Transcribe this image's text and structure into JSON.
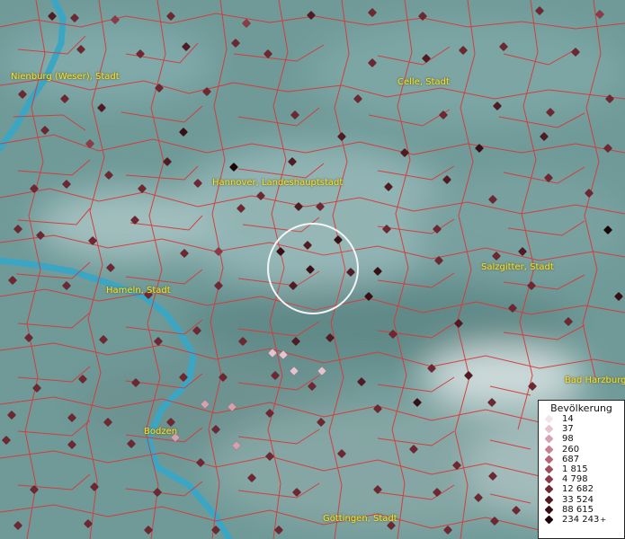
{
  "map": {
    "cities": [
      {
        "name": "Nienburg (Weser), Stadt"
      },
      {
        "name": "Celle, Stadt"
      },
      {
        "name": "Hannover, Landeshauptstadt"
      },
      {
        "name": "Hameln, Stadt"
      },
      {
        "name": "Salzgitter, Stadt"
      },
      {
        "name": "Bad Harzburg"
      },
      {
        "name": "Bodzen"
      },
      {
        "name": "Göttingen, Stadt"
      }
    ],
    "colors": {
      "terrain": "#6f9a98",
      "river": "#3aa6c4",
      "boundary": "#d63a3a",
      "label": "#f2e23a"
    }
  },
  "legend": {
    "title": "Bevölkerung",
    "items": [
      {
        "label": "14",
        "color": "#f3e3ea"
      },
      {
        "label": "37",
        "color": "#e7c2cf"
      },
      {
        "label": "98",
        "color": "#d7a0b0"
      },
      {
        "label": "260",
        "color": "#c77f92"
      },
      {
        "label": "687",
        "color": "#b86476"
      },
      {
        "label": "1 815",
        "color": "#a24d5d"
      },
      {
        "label": "4 798",
        "color": "#8e3b47"
      },
      {
        "label": "12 682",
        "color": "#6f2732"
      },
      {
        "label": "33 524",
        "color": "#521a22"
      },
      {
        "label": "88 615",
        "color": "#3a0e14"
      },
      {
        "label": "234 243",
        "color": "#1c0508",
        "plus": "+"
      }
    ]
  }
}
